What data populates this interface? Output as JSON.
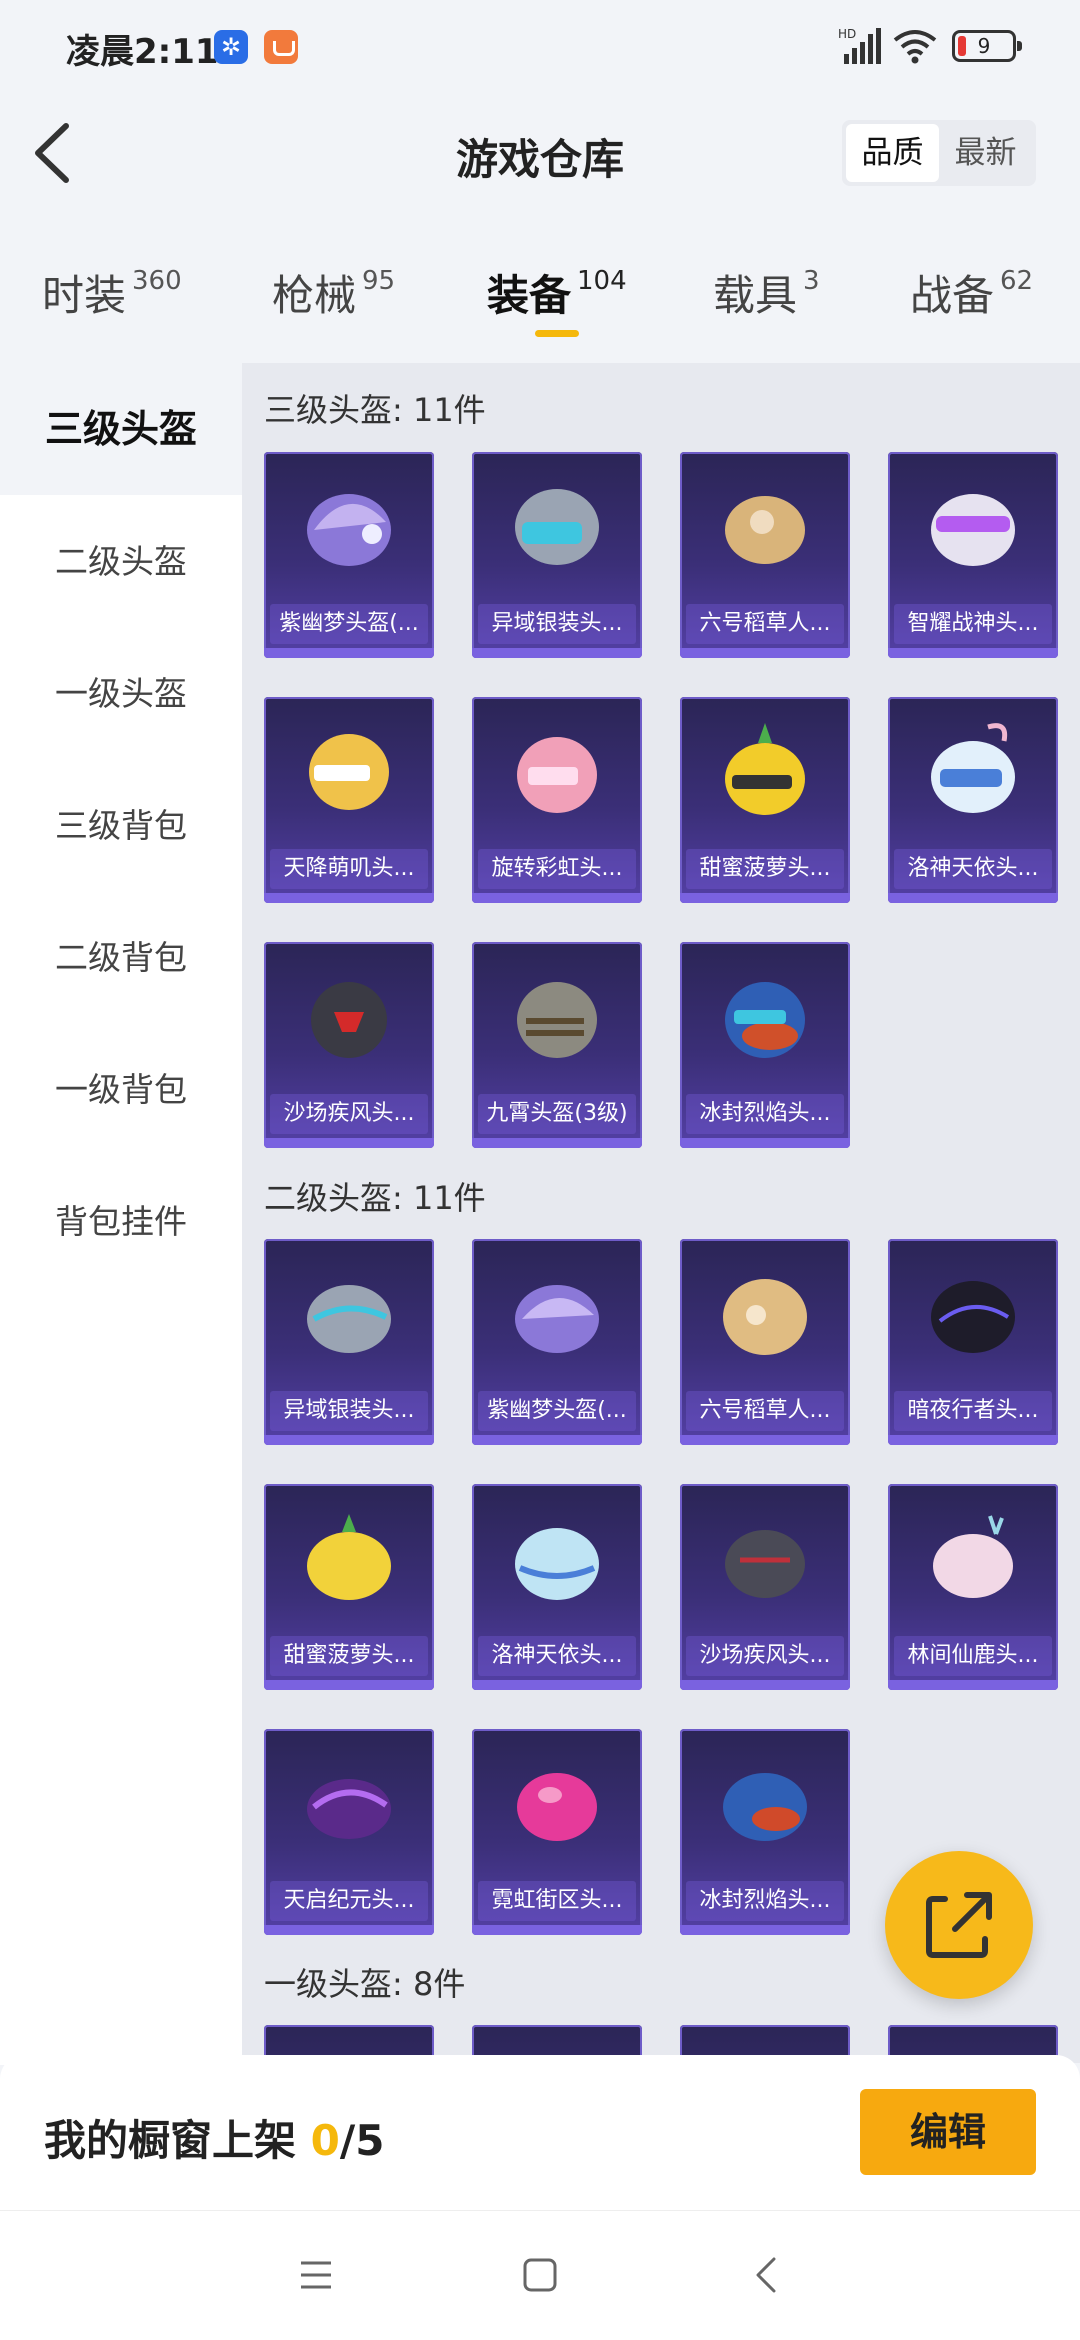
{
  "status": {
    "time": "凌晨2:11",
    "battery": "9",
    "network": "HD"
  },
  "header": {
    "title": "游戏仓库",
    "sort_options": [
      "品质",
      "最新"
    ]
  },
  "tabs": [
    {
      "label": "时装",
      "count": "360"
    },
    {
      "label": "枪械",
      "count": "95"
    },
    {
      "label": "装备",
      "count": "104"
    },
    {
      "label": "载具",
      "count": "3"
    },
    {
      "label": "战备",
      "count": "62"
    }
  ],
  "sidebar": {
    "items": [
      "三级头盔",
      "二级头盔",
      "一级头盔",
      "三级背包",
      "二级背包",
      "一级背包",
      "背包挂件"
    ]
  },
  "sections": [
    {
      "title": "三级头盔: 11件",
      "items": [
        "紫幽梦头盔(...",
        "异域银装头...",
        "六号稻草人...",
        "智耀战神头...",
        "天降萌叽头...",
        "旋转彩虹头...",
        "甜蜜菠萝头...",
        "洛神天依头...",
        "沙场疾风头...",
        "九霄头盔(3级)",
        "冰封烈焰头..."
      ]
    },
    {
      "title": "二级头盔: 11件",
      "items": [
        "异域银装头...",
        "紫幽梦头盔(...",
        "六号稻草人...",
        "暗夜行者头...",
        "甜蜜菠萝头...",
        "洛神天依头...",
        "沙场疾风头...",
        "林间仙鹿头...",
        "天启纪元头...",
        "霓虹街区头...",
        "冰封烈焰头..."
      ]
    },
    {
      "title": "一级头盔: 8件",
      "items": []
    }
  ],
  "bottom": {
    "showcase_label": "我的橱窗上架",
    "showcase_current": "0",
    "showcase_total": "/5",
    "edit_label": "编辑"
  },
  "colors": {
    "accent": "#f5b80c",
    "card_bg": "#3b2f78",
    "card_border": "#6e5cc8"
  }
}
